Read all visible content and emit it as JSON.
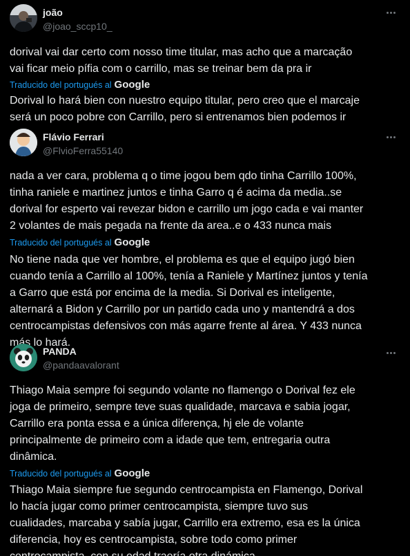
{
  "posts": [
    {
      "name": "joão",
      "handle": "@joao_sccp10_",
      "original": "dorival vai dar certo com nosso time titular, mas acho que a marcação\nvai ficar meio pífia com o carrillo, mas se treinar bem da pra ir",
      "translated_label": "Traducido del portugués al",
      "google_label": "Google",
      "translation": "Dorival lo hará bien con nuestro equipo titular, pero creo que el marcaje\nserá un poco pobre con Carrillo, pero si entrenamos bien podemos ir",
      "avatar_icon": "person-photo-icon"
    },
    {
      "name": "Flávio Ferrari",
      "handle": "@FlvioFerra55140",
      "original": "nada a ver cara, problema q o time jogou bem qdo tinha Carrillo 100%,\ntinha raniele e martinez juntos e tinha Garro q é acima da media..se\ndorival for esperto vai revezar bidon e carrillo um jogo cada e vai manter\n2 volantes de mais pegada na frente da area..e o 433 nunca mais",
      "translated_label": "Traducido del portugués al",
      "google_label": "Google",
      "translation": "No tiene nada que ver hombre, el problema es que el equipo jugó bien\ncuando tenía a Carrillo al 100%, tenía a Raniele y Martínez juntos y tenía\na Garro que está por encima de la media. Si Dorival es inteligente,\nalternará a Bidon y Carrillo por un partido cada uno y mantendrá a dos\ncentrocampistas defensivos con más agarre frente al área. Y 433 nunca\nmás lo hará.",
      "avatar_icon": "cartoon-avatar-icon"
    },
    {
      "name": "PANDA",
      "handle": "@pandaavalorant",
      "original": "Thiago Maia sempre foi segundo volante no flamengo o Dorival fez ele\njoga de primeiro, sempre teve suas qualidade, marcava e sabia jogar,\nCarrillo era ponta essa e a única diferença, hj ele de volante\nprincipalmente de primeiro com a idade que tem, entregaria outra\ndinâmica.",
      "translated_label": "Traducido del portugués al",
      "google_label": "Google",
      "translation": "Thiago Maia siempre fue segundo centrocampista en Flamengo, Dorival\nlo hacía jugar como primer centrocampista, siempre tuvo sus\ncualidades, marcaba y sabía jugar, Carrillo era extremo, esa es la única\ndiferencia, hoy es centrocampista, sobre todo como primer\ncentrocampista, con su edad traería otra dinámica.",
      "avatar_icon": "panda-avatar-icon"
    }
  ]
}
